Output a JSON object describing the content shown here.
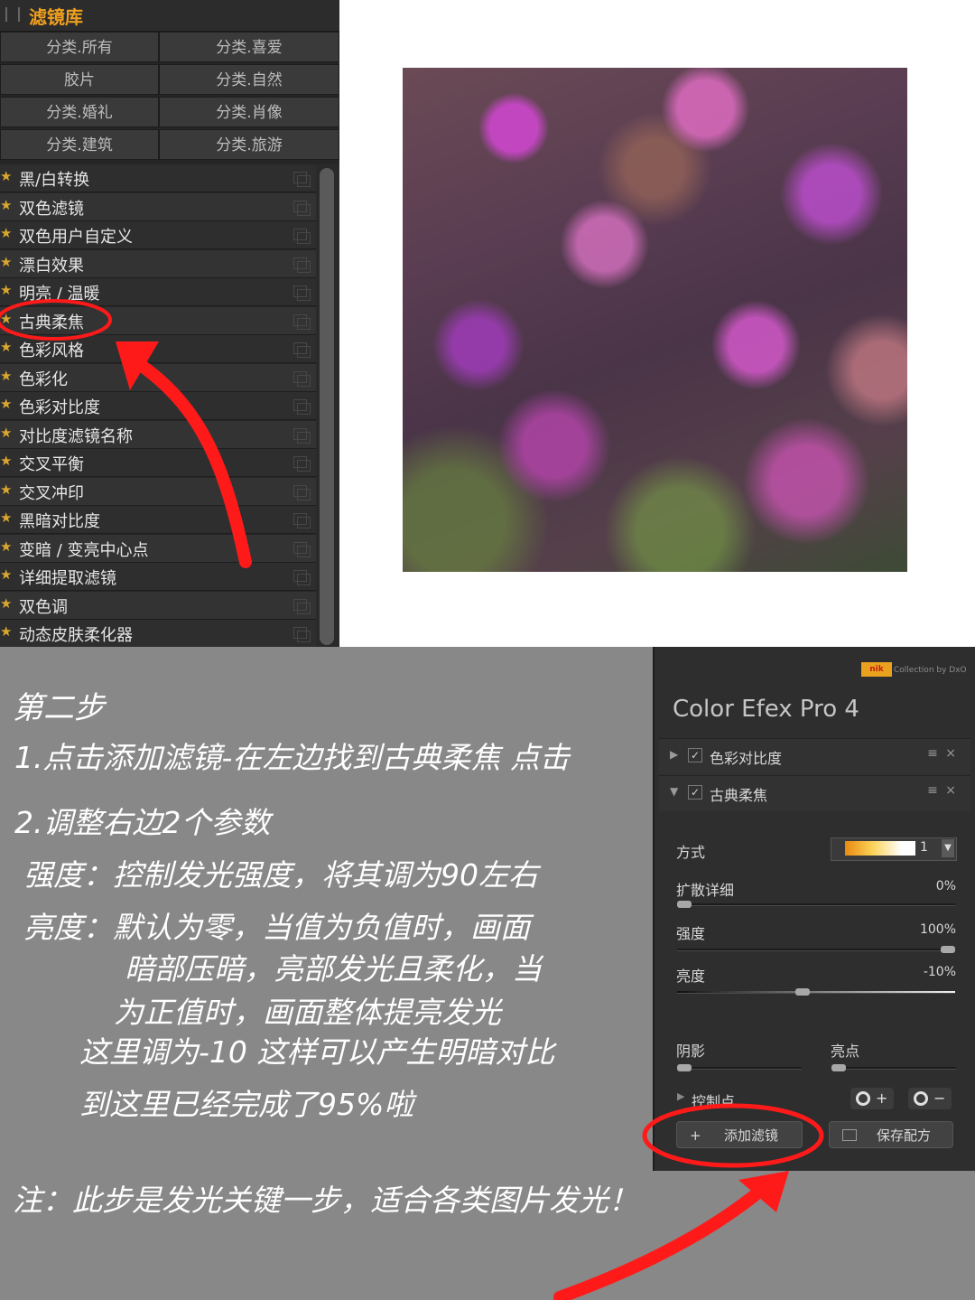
{
  "library": {
    "title": "滤镜库",
    "categories": [
      "分类.所有",
      "分类.喜爱",
      "胶片",
      "分类.自然",
      "分类.婚礼",
      "分类.肖像",
      "分类.建筑",
      "分类.旅游"
    ],
    "items": [
      "黑/白转换",
      "双色滤镜",
      "双色用户自定义",
      "漂白效果",
      "明亮 / 温暖",
      "古典柔焦",
      "色彩风格",
      "色彩化",
      "色彩对比度",
      "对比度滤镜名称",
      "交叉平衡",
      "交叉冲印",
      "黑暗对比度",
      "变暗 / 变亮中心点",
      "详细提取滤镜",
      "双色调",
      "动态皮肤柔化器"
    ],
    "highlighted_item": "古典柔焦"
  },
  "instructions": {
    "step": "第二步",
    "line1": "1.点击添加滤镜-在左边找到古典柔焦 点击",
    "line2": "2.调整右边2个参数",
    "line3": "强度：控制发光强度，将其调为90左右",
    "line4": "亮度：默认为零，当值为负值时，画面",
    "line5": "暗部压暗，亮部发光且柔化，当",
    "line6": "为正值时，画面整体提亮发光",
    "line7": "这里调为-10 这样可以产生明暗对比",
    "line8": "到这里已经完成了95%啦",
    "note": "注：此步是发光关键一步，适合各类图片发光！"
  },
  "efex": {
    "logo": "nik",
    "logo_caption": "Collection by DxO",
    "title": "Color Efex Pro 4",
    "filters": [
      {
        "name": "色彩对比度",
        "expanded": false,
        "enabled": true
      },
      {
        "name": "古典柔焦",
        "expanded": true,
        "enabled": true
      }
    ],
    "actions_icons": "≡ ×",
    "mode_label": "方式",
    "mode_value": "1",
    "params": [
      {
        "label": "扩散详细",
        "value": "0%",
        "level": 0.0
      },
      {
        "label": "强度",
        "value": "100%",
        "level": 1.0
      },
      {
        "label": "亮度",
        "value": "-10%",
        "level": 0.45
      }
    ],
    "shadows_label": "阴影",
    "highlights_label": "亮点",
    "control_points_label": "控制点",
    "cp_plus": "+",
    "cp_minus": "−",
    "add_filter": "添加滤镜",
    "save_recipe": "保存配方",
    "plus_symbol": "+"
  },
  "colors": {
    "library_title": "#f0a01e",
    "annotation_red": "#ff1a1a",
    "background_gray": "#888888",
    "panel_dark": "#2e2e2e"
  }
}
